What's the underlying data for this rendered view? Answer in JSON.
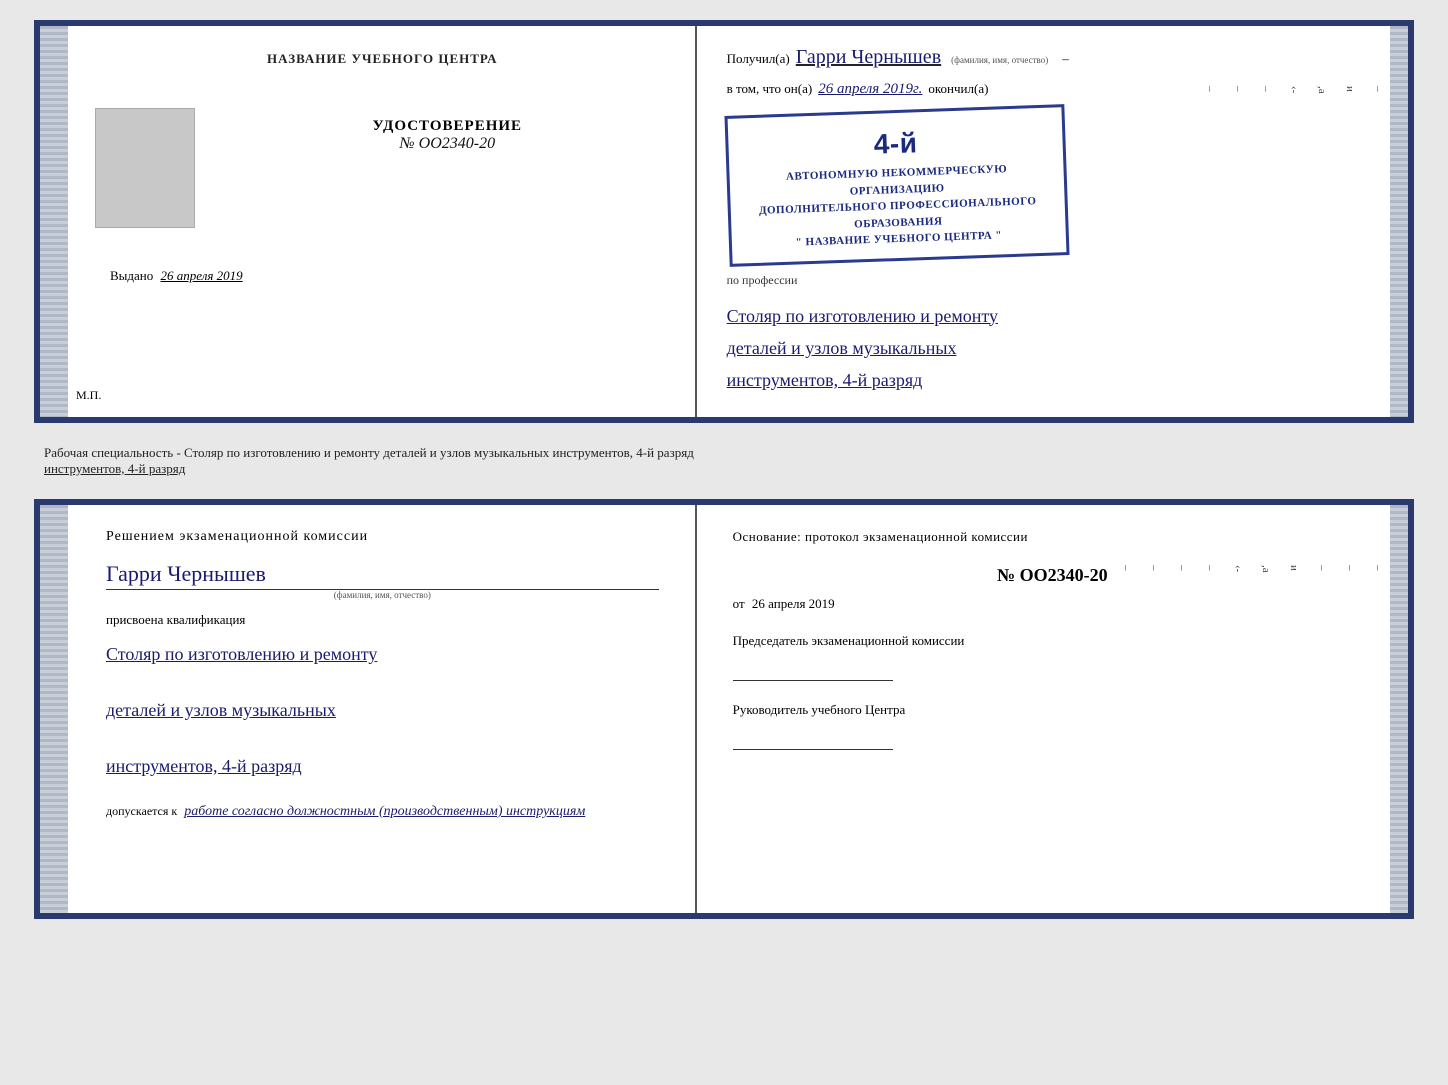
{
  "top_document": {
    "left": {
      "title": "НАЗВАНИЕ УЧЕБНОГО ЦЕНТРА",
      "udostoverenie_label": "УДОСТОВЕРЕНИЕ",
      "number": "№ OO2340-20",
      "vydano_label": "Выдано",
      "vydano_date": "26 апреля 2019",
      "mp_label": "М.П."
    },
    "right": {
      "poluchil_prefix": "Получил(а)",
      "recipient_name": "Гарри Чернышев",
      "fio_label": "(фамилия, имя, отчество)",
      "vtom_prefix": "в том, что он(а)",
      "date": "26 апреля 2019г.",
      "okonchil_label": "окончил(а)",
      "stamp_line1": "АВТОНОМНУЮ НЕКОММЕРЧЕСКУЮ ОРГАНИЗАЦИЮ",
      "stamp_line2": "ДОПОЛНИТЕЛЬНОГО ПРОФЕССИОНАЛЬНОГО ОБРАЗОВАНИЯ",
      "stamp_line3": "\"  НАЗВАНИЕ УЧЕБНОГО ЦЕНТРА  \"",
      "stamp_number": "4-й",
      "po_professii": "по профессии",
      "profession_line1": "Столяр по изготовлению и ремонту",
      "profession_line2": "деталей и узлов музыкальных",
      "profession_line3": "инструментов, 4-й разряд"
    }
  },
  "between_text": "Рабочая специальность - Столяр по изготовлению и ремонту деталей и узлов музыкальных инструментов, 4-й разряд",
  "bottom_document": {
    "left": {
      "resheniem": "Решением  экзаменационной  комиссии",
      "recipient_name": "Гарри Чернышев",
      "fio_label": "(фамилия, имя, отчество)",
      "prisvoena": "присвоена квалификация",
      "profession_line1": "Столяр по изготовлению и ремонту",
      "profession_line2": "деталей и узлов музыкальных",
      "profession_line3": "инструментов, 4-й разряд",
      "dopuskaetsya": "допускается к",
      "dopusk_italic": "работе согласно должностным (производственным) инструкциям"
    },
    "right": {
      "osnovanie": "Основание:  протокол  экзаменационной  комиссии",
      "protocol_number": "№  OO2340-20",
      "ot_label": "от",
      "ot_date": "26 апреля 2019",
      "predsedatel": "Председатель экзаменационной комиссии",
      "rukovoditel": "Руководитель учебного Центра"
    }
  }
}
